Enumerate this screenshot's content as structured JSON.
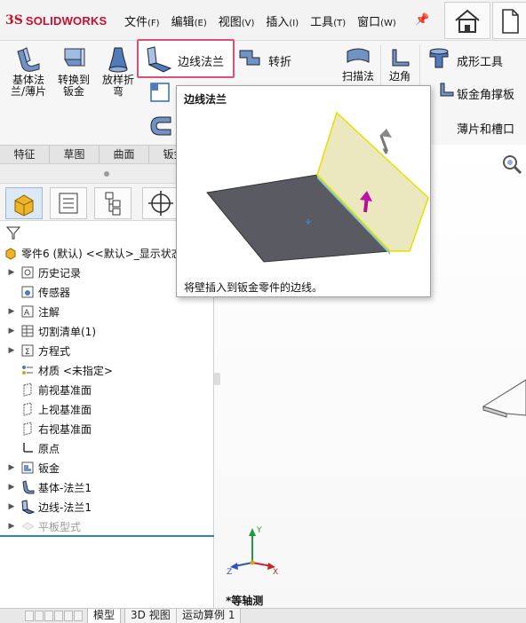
{
  "app": {
    "logo_text": "SOLIDWORKS",
    "logo_mark": "3S"
  },
  "menu": [
    {
      "label": "文件",
      "key": "(F)"
    },
    {
      "label": "编辑",
      "key": "(E)"
    },
    {
      "label": "视图",
      "key": "(V)"
    },
    {
      "label": "插入",
      "key": "(I)"
    },
    {
      "label": "工具",
      "key": "(T)"
    },
    {
      "label": "窗口",
      "key": "(W)"
    }
  ],
  "ribbon": {
    "base_flange": "基体法\n兰/薄片",
    "convert_sheet": "转换到\n钣金",
    "lofted_bend": "放样折\n弯",
    "edge_flange": "边线法兰",
    "jog": "转折",
    "sweep": "扫描法",
    "corner": "边角",
    "forming_tool": "成形工具",
    "corner_brace": "钣金角撑板",
    "tab_slot": "薄片和槽口"
  },
  "cm_tabs": [
    "特征",
    "草图",
    "曲面",
    "钣金"
  ],
  "tooltip": {
    "title": "边线法兰",
    "description": "将壁插入到钣金零件的边线。"
  },
  "tree": {
    "root": "零件6 (默认) <<默认>_显示状态",
    "items": [
      {
        "label": "历史记录",
        "expand": true,
        "icon": "history-icon"
      },
      {
        "label": "传感器",
        "expand": false,
        "icon": "sensor-icon"
      },
      {
        "label": "注解",
        "expand": true,
        "icon": "annotation-icon"
      },
      {
        "label": "切割清单(1)",
        "expand": true,
        "icon": "cutlist-icon"
      },
      {
        "label": "方程式",
        "expand": true,
        "icon": "equation-icon"
      },
      {
        "label": "材质 <未指定>",
        "expand": false,
        "icon": "material-icon"
      },
      {
        "label": "前视基准面",
        "expand": false,
        "icon": "plane-icon"
      },
      {
        "label": "上视基准面",
        "expand": false,
        "icon": "plane-icon"
      },
      {
        "label": "右视基准面",
        "expand": false,
        "icon": "plane-icon"
      },
      {
        "label": "原点",
        "expand": false,
        "icon": "origin-icon"
      },
      {
        "label": "钣金",
        "expand": true,
        "icon": "sheetmetal-icon"
      },
      {
        "label": "基体-法兰1",
        "expand": true,
        "icon": "base-flange-icon"
      },
      {
        "label": "边线-法兰1",
        "expand": true,
        "icon": "edge-flange-icon"
      },
      {
        "label": "平板型式",
        "expand": true,
        "icon": "flat-pattern-icon",
        "dimmed": true
      }
    ]
  },
  "view": {
    "orientation_label": "*等轴测",
    "triad": {
      "x": "X",
      "y": "Y",
      "z": "Z"
    }
  },
  "bottom_tabs": [
    "模型",
    "3D 视图",
    "运动算例 1"
  ],
  "colors": {
    "accent_highlight": "#e05070",
    "selection_blue": "#2f7fd0",
    "brand_red": "#c8102e"
  }
}
